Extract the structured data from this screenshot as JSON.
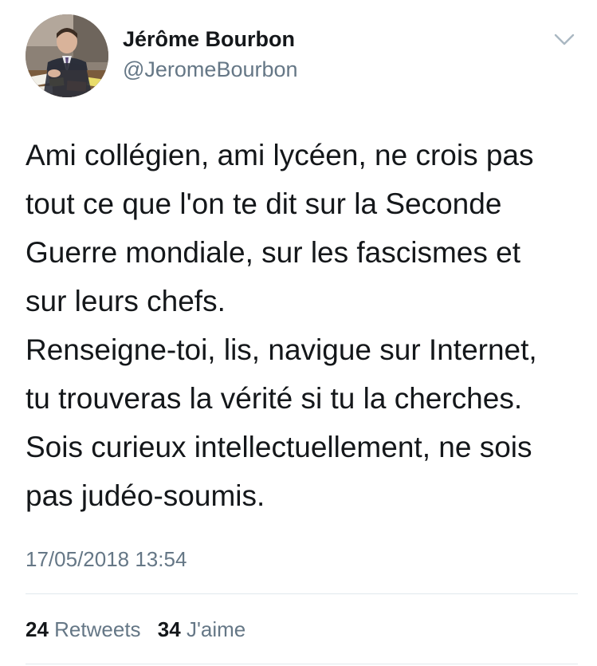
{
  "tweet": {
    "author_name": "Jérôme Bourbon",
    "author_handle": "@JeromeBourbon",
    "text_lines": [
      "Ami collégien, ami lycéen, ne crois pas",
      "tout ce que l'on te dit sur la Seconde",
      "Guerre mondiale, sur les fascismes et",
      "sur leurs chefs.",
      "Renseigne-toi, lis, navigue sur Internet,",
      "tu trouveras la vérité si tu la cherches.",
      "Sois curieux intellectuellement, ne sois",
      "pas judéo-soumis."
    ],
    "timestamp": "17/05/2018 13:54",
    "retweets_count": "24",
    "retweets_label": "Retweets",
    "likes_count": "34",
    "likes_label": "J'aime"
  },
  "icons": {
    "menu": "chevron-down-icon",
    "avatar": "profile-photo"
  },
  "colors": {
    "primary_text": "#14171a",
    "secondary_text": "#657786",
    "divider": "#e1e8ed",
    "background": "#ffffff"
  }
}
